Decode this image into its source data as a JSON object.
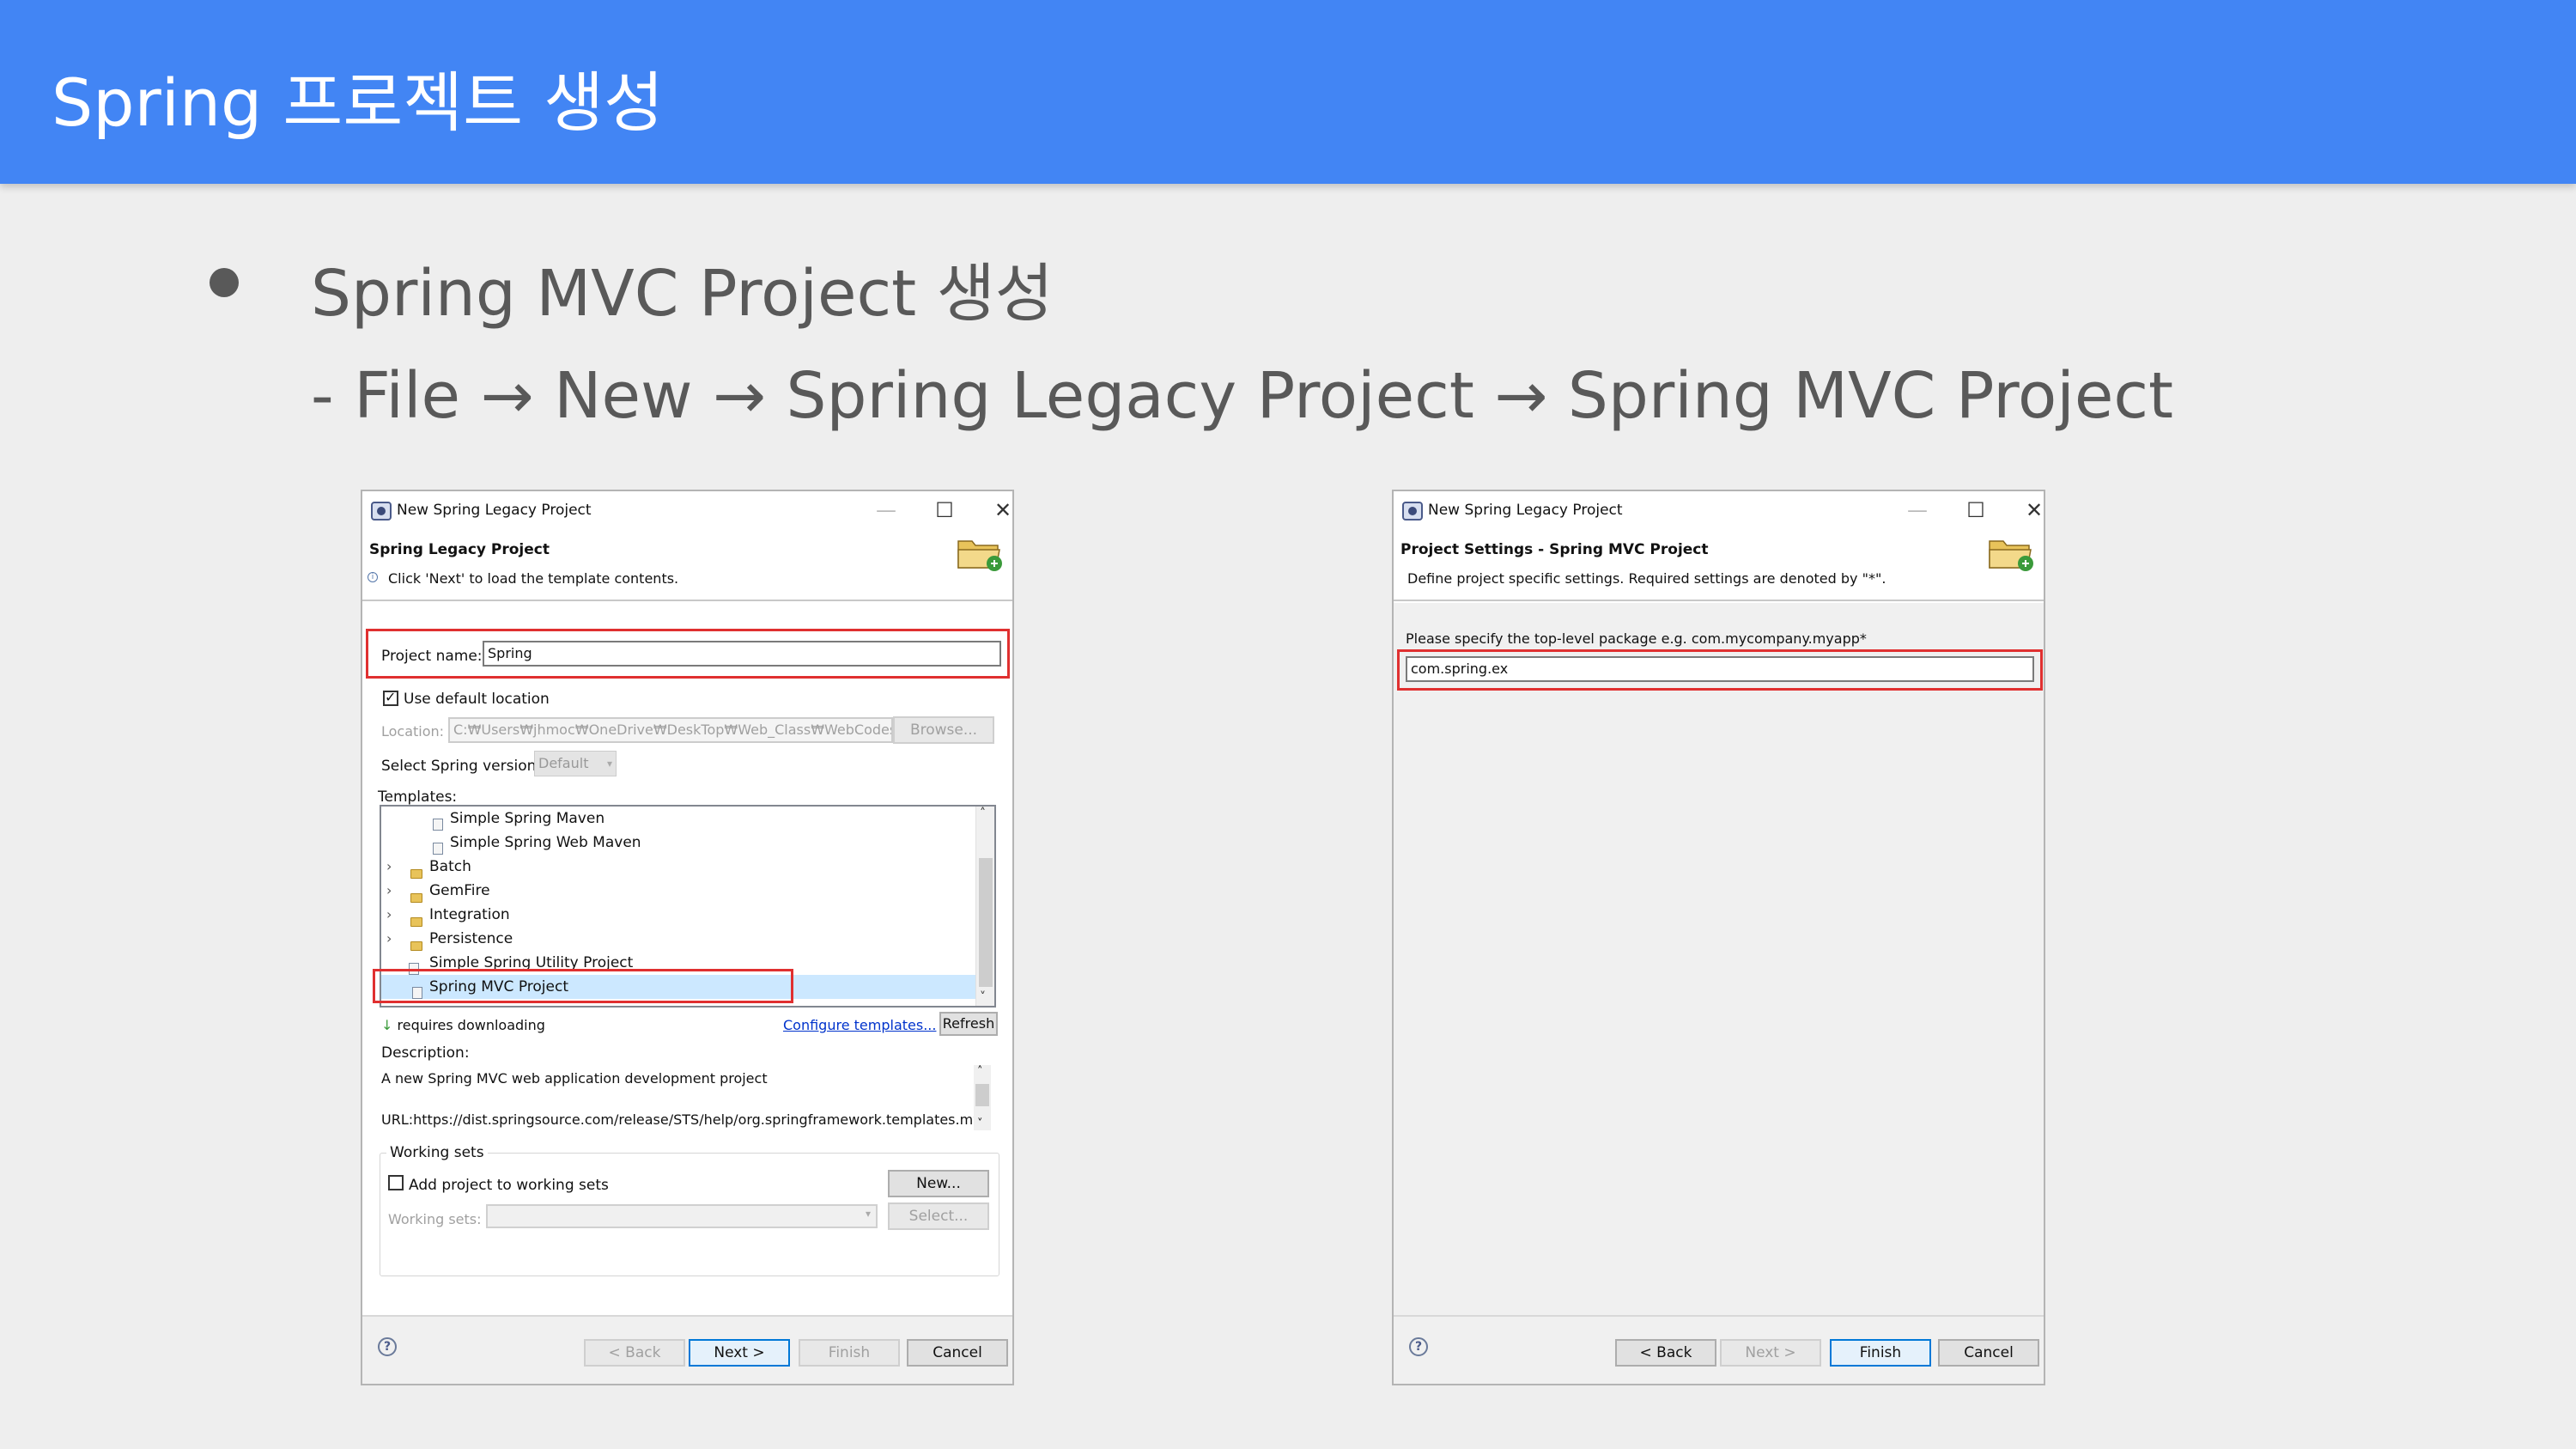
{
  "slide": {
    "title": "Spring 프로젝트 생성",
    "bullet": "Spring MVC Project 생성",
    "path": "- File → New → Spring Legacy Project → Spring MVC Project"
  },
  "colors": {
    "header": "#4285f4",
    "highlight": "#e03030",
    "selection": "#cce8ff"
  },
  "left_dialog": {
    "window_title": "New Spring Legacy Project",
    "heading": "Spring Legacy Project",
    "subtext": "Click 'Next' to load the template contents.",
    "project_name_label": "Project name:",
    "project_name_value": "Spring",
    "use_default_location": "Use default location",
    "location_label": "Location:",
    "location_value": "C:₩Users₩jhmoc₩OneDrive₩DeskTop₩Web_Class₩WebCodes",
    "browse": "Browse...",
    "spring_version_label": "Select Spring version:",
    "spring_version_value": "Default",
    "templates_label": "Templates:",
    "templates": [
      {
        "label": "Simple Spring Maven"
      },
      {
        "label": "Simple Spring Web Maven"
      },
      {
        "label": "Batch"
      },
      {
        "label": "GemFire"
      },
      {
        "label": "Integration"
      },
      {
        "label": "Persistence"
      },
      {
        "label": "Simple Spring Utility Project"
      },
      {
        "label": "Spring MVC Project"
      }
    ],
    "requires_downloading": "requires downloading",
    "configure_templates": "Configure templates...",
    "refresh": "Refresh",
    "description_label": "Description:",
    "description_text": "A new Spring MVC web application development project",
    "url_text": "URL:https://dist.springsource.com/release/STS/help/org.springframework.templates.mv",
    "working_sets_group": "Working sets",
    "add_to_working_sets": "Add project to working sets",
    "new_button": "New...",
    "working_sets_label": "Working sets:",
    "select_button": "Select...",
    "back": "< Back",
    "next": "Next >",
    "finish": "Finish",
    "cancel": "Cancel"
  },
  "right_dialog": {
    "window_title": "New Spring Legacy Project",
    "heading": "Project Settings - Spring MVC Project",
    "subtext": "Define project specific settings. Required settings are denoted by \"*\".",
    "package_label": "Please specify the top-level package e.g. com.mycompany.myapp*",
    "package_value": "com.spring.ex",
    "back": "< Back",
    "next": "Next >",
    "finish": "Finish",
    "cancel": "Cancel"
  }
}
